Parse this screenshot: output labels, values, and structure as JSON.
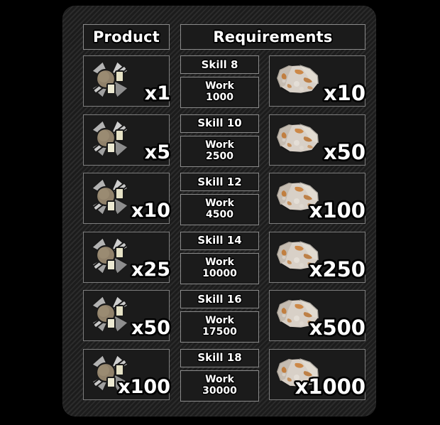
{
  "panel": {
    "title": "production-recipe-table"
  },
  "header": {
    "product_label": "Product",
    "requirements_label": "Requirements"
  },
  "icons": {
    "product_icon_name": "crossed-blades-machine-part-icon",
    "ore_icon_name": "stone-ore-icon"
  },
  "labels": {
    "work_label": "Work",
    "skill_prefix": "Skill"
  },
  "colors": {
    "panel_background": "#232323",
    "cell_background": "#1b1b1b",
    "cell_border": "#8a8a8a",
    "text": "#ffffff",
    "outer_background": "#000000",
    "ore_base": "#d6cdc4",
    "ore_vein": "#c4762f",
    "product_metal": "#9a9a9a",
    "product_hub": "#8f8066",
    "product_tan": "#e3e0c4"
  },
  "rows": [
    {
      "product_qty": "x1",
      "skill": "Skill 8",
      "work_label": "Work",
      "work_value": "1000",
      "ore_qty": "x10"
    },
    {
      "product_qty": "x5",
      "skill": "Skill 10",
      "work_label": "Work",
      "work_value": "2500",
      "ore_qty": "x50"
    },
    {
      "product_qty": "x10",
      "skill": "Skill 12",
      "work_label": "Work",
      "work_value": "4500",
      "ore_qty": "x100"
    },
    {
      "product_qty": "x25",
      "skill": "Skill 14",
      "work_label": "Work",
      "work_value": "10000",
      "ore_qty": "x250"
    },
    {
      "product_qty": "x50",
      "skill": "Skill 16",
      "work_label": "Work",
      "work_value": "17500",
      "ore_qty": "x500"
    },
    {
      "product_qty": "x100",
      "skill": "Skill 18",
      "work_label": "Work",
      "work_value": "30000",
      "ore_qty": "x1000"
    }
  ]
}
